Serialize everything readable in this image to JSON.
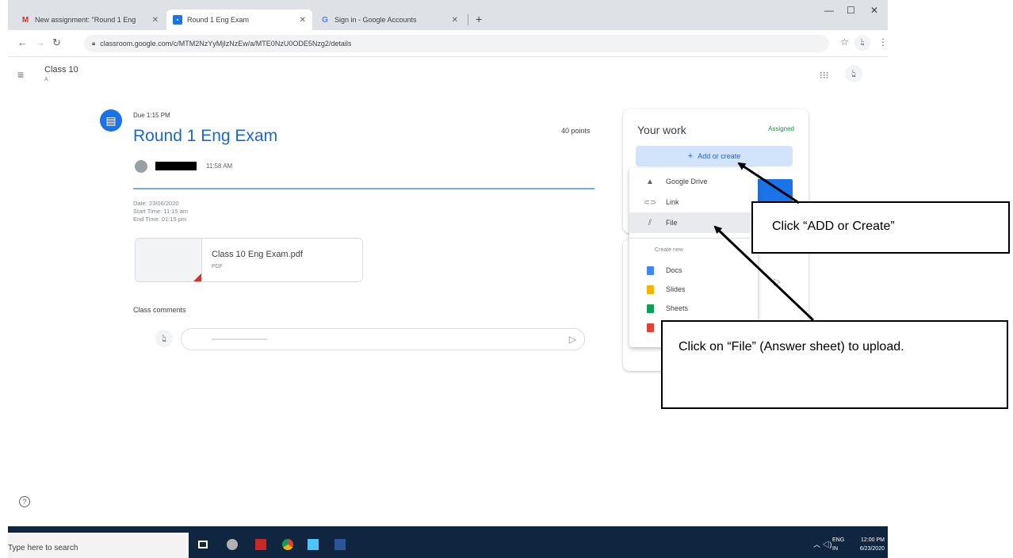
{
  "browser": {
    "tabs": [
      {
        "label": "New assignment: \"Round 1 Eng",
        "icon": "gmail-icon"
      },
      {
        "label": "Round 1 Eng Exam",
        "icon": "classroom-icon"
      },
      {
        "label": "Sign in - Google Accounts",
        "icon": "google-icon"
      }
    ],
    "url": "classroom.google.com/c/MTM2NzYyMjIzNzEw/a/MTE0NzU0ODE5Nzg2/details"
  },
  "header": {
    "class_name": "Class 10",
    "section": "A"
  },
  "assignment": {
    "due": "Due 1:15 PM",
    "title": "Round 1 Eng Exam",
    "points": "40 points",
    "posted_time": "11:58 AM",
    "description": {
      "date": "Date: 23/06/2020",
      "start": "Start Time: 11:15 am",
      "end": "End Time: 01:15 pm"
    },
    "attachment": {
      "name": "Class 10 Eng Exam.pdf",
      "type": "PDF"
    },
    "comments_label": "Class comments"
  },
  "work": {
    "heading": "Your work",
    "status": "Assigned",
    "add_button": "Add or create",
    "menu": {
      "items": [
        {
          "label": "Google Drive",
          "icon": "google-drive-icon"
        },
        {
          "label": "Link",
          "icon": "link-icon"
        },
        {
          "label": "File",
          "icon": "paperclip-icon"
        }
      ],
      "create_new_label": "Create new",
      "create_items": [
        {
          "label": "Docs",
          "icon": "docs-icon",
          "color": "#4285f4"
        },
        {
          "label": "Slides",
          "icon": "slides-icon",
          "color": "#f4b400"
        },
        {
          "label": "Sheets",
          "icon": "sheets-icon",
          "color": "#0f9d58"
        }
      ]
    }
  },
  "taskbar": {
    "search_text": "Type here to search",
    "lang_top": "ENG",
    "lang_bottom": "IN",
    "time": "12:00 PM",
    "date": "6/23/2020"
  },
  "annotations": {
    "callout_add": "Click “ADD or Create”",
    "callout_file": "Click on “File” (Answer sheet) to upload."
  },
  "colors": {
    "accent": "#1a73e8",
    "title": "#1967d2",
    "status": "#1e8e3e",
    "taskbar": "#10253f"
  }
}
